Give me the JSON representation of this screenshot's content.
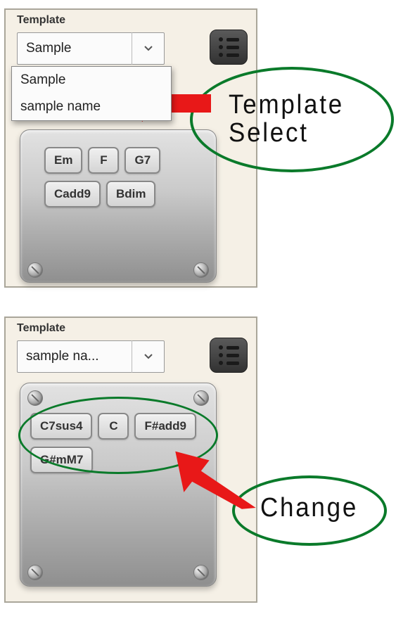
{
  "panel1": {
    "label": "Template",
    "selected": "Sample",
    "options": [
      "Sample",
      "sample name"
    ],
    "chords_row1": [
      "Em",
      "F",
      "G7"
    ],
    "chords_row2": [
      "Cadd9",
      "Bdim"
    ]
  },
  "panel2": {
    "label": "Template",
    "selected": "sample na...",
    "chords_row1": [
      "C7sus4",
      "C",
      "F#add9"
    ],
    "chords_row2": [
      "G#mM7"
    ]
  },
  "callout1": {
    "line1": "Template",
    "line2": "Select"
  },
  "callout2": {
    "text": "Change"
  }
}
